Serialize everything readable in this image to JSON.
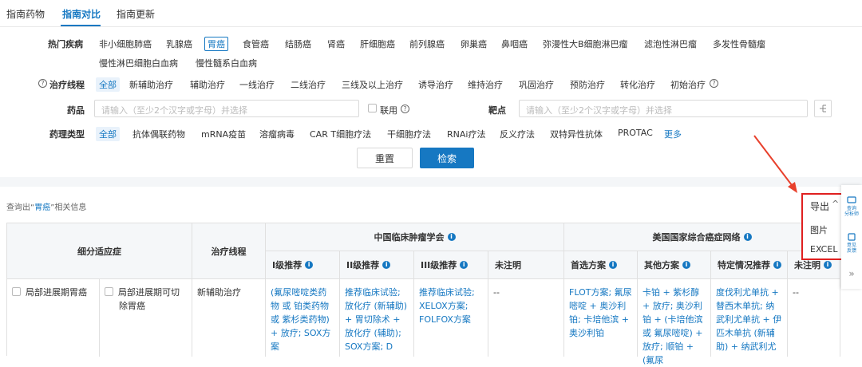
{
  "tabs": [
    "指南药物",
    "指南对比",
    "指南更新"
  ],
  "filters": {
    "disease_label": "热门疾病",
    "diseases_row1": [
      "非小细胞肺癌",
      "乳腺癌",
      "胃癌",
      "食管癌",
      "结肠癌",
      "肾癌",
      "肝细胞癌",
      "前列腺癌",
      "卵巢癌",
      "鼻咽癌",
      "弥漫性大B细胞淋巴瘤",
      "滤泡性淋巴瘤",
      "多发性骨髓瘤"
    ],
    "diseases_row2": [
      "慢性淋巴细胞白血病",
      "慢性髓系白血病"
    ],
    "line_label": "治疗线程",
    "lines": [
      "全部",
      "新辅助治疗",
      "辅助治疗",
      "一线治疗",
      "二线治疗",
      "三线及以上治疗",
      "诱导治疗",
      "维持治疗",
      "巩固治疗",
      "预防治疗",
      "转化治疗",
      "初始治疗"
    ],
    "drug_label": "药品",
    "drug_placeholder": "请输入（至少2个汉字或字母）并选择",
    "combo_label": "联用",
    "target_label": "靶点",
    "target_placeholder": "请输入（至少2个汉字或字母）并选择",
    "pharm_label": "药理类型",
    "pharm_types": [
      "全部",
      "抗体偶联药物",
      "mRNA疫苗",
      "溶瘤病毒",
      "CAR T细胞疗法",
      "干细胞疗法",
      "RNAi疗法",
      "反义疗法",
      "双特异性抗体",
      "PROTAC",
      "更多"
    ]
  },
  "buttons": {
    "reset": "重置",
    "search": "检索"
  },
  "result_info": {
    "prefix": "查询出“",
    "keyword": "胃癌",
    "suffix": "”相关信息"
  },
  "export": {
    "label": "导出",
    "options": [
      "图片",
      "EXCEL"
    ]
  },
  "side_panel": [
    {
      "icon": "chart-icon",
      "label1": "查询",
      "label2": "分析师"
    },
    {
      "icon": "feedback-icon",
      "label1": "意见",
      "label2": "反馈"
    }
  ],
  "table": {
    "col_subindication": "细分适应症",
    "col_line": "治疗线程",
    "group_csco": "中国临床肿瘤学会",
    "group_nccn": "美国国家综合癌症网络",
    "csco_cols": [
      "I级推荐",
      "II级推荐",
      "III级推荐",
      "未注明"
    ],
    "nccn_cols": [
      "首选方案",
      "其他方案",
      "特定情况推荐",
      "未注明"
    ],
    "row": {
      "indication": "局部进展期胃癌",
      "sub": "局部进展期可切除胃癌",
      "line": "新辅助治疗",
      "csco_1": "(氟尿嘧啶类药物 或 铂类药物 或 紫杉类药物) + 放疗; SOX方案",
      "csco_2": "推荐临床试验; 放化疗 (新辅助) + 胃切除术 + 放化疗 (辅助); SOX方案; D",
      "csco_3": "推荐临床试验; XELOX方案; FOLFOX方案",
      "csco_4": "--",
      "nccn_1": "FLOT方案; 氟尿嘧啶 + 奥沙利铂; 卡培他滨 + 奥沙利铂",
      "nccn_2": "卡铂 + 紫杉醇 + 放疗; 奥沙利铂 + (卡培他滨 或 氟尿嘧啶) + 放疗; 顺铂 + (氟尿",
      "nccn_3": "度伐利尤单抗 + 替西木单抗; 纳武利尤单抗 + 伊匹木单抗 (新辅助) + 纳武利尤",
      "nccn_4": "--"
    }
  }
}
